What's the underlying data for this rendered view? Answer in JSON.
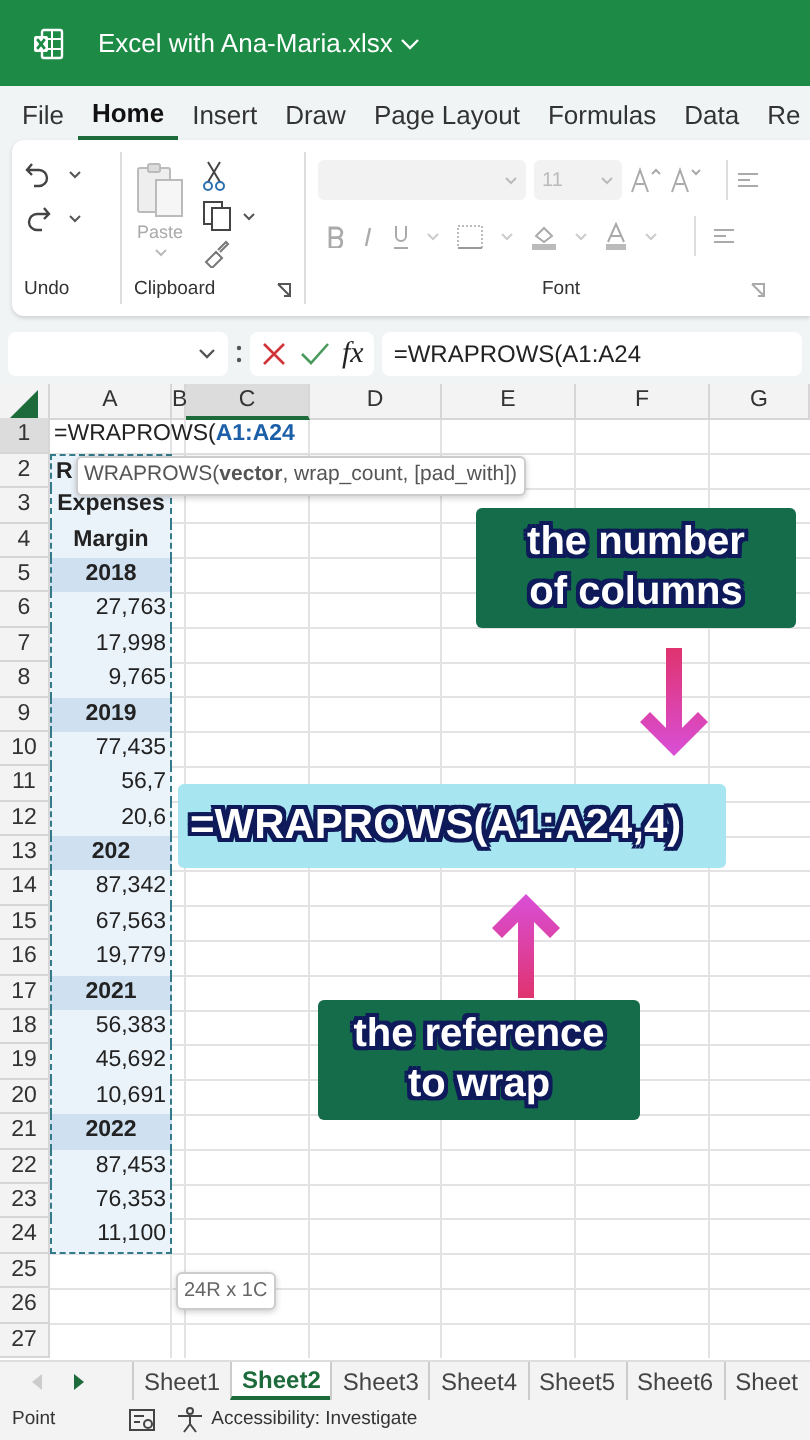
{
  "title_bar": {
    "file_name": "Excel with Ana-Maria.xlsx"
  },
  "menu_tabs": [
    {
      "label": "File",
      "selected": false
    },
    {
      "label": "Home",
      "selected": true
    },
    {
      "label": "Insert",
      "selected": false
    },
    {
      "label": "Draw",
      "selected": false
    },
    {
      "label": "Page Layout",
      "selected": false
    },
    {
      "label": "Formulas",
      "selected": false
    },
    {
      "label": "Data",
      "selected": false
    },
    {
      "label": "Re",
      "selected": false
    }
  ],
  "ribbon": {
    "paste_label": "Paste",
    "font_size": "11",
    "groups": [
      {
        "label": "Undo"
      },
      {
        "label": "Clipboard"
      },
      {
        "label": "Font"
      }
    ]
  },
  "formula_bar": {
    "function_button": "fx",
    "formula": "=WRAPROWS(A1:A24"
  },
  "columns": [
    {
      "label": "A",
      "selected": false
    },
    {
      "label": "B",
      "selected": false
    },
    {
      "label": "C",
      "selected": true
    },
    {
      "label": "D",
      "selected": false
    },
    {
      "label": "E",
      "selected": false
    },
    {
      "label": "F",
      "selected": false
    },
    {
      "label": "G",
      "selected": false
    }
  ],
  "rows": [
    {
      "number": "1",
      "selected": true,
      "kind": "formula",
      "formula_start": "=WRAPROWS(",
      "formula_reference": "A1:A24"
    },
    {
      "number": "2",
      "selected": false,
      "kind": "label",
      "in_range": true,
      "value": "R"
    },
    {
      "number": "3",
      "selected": false,
      "kind": "header",
      "in_range": true,
      "value": "Expenses"
    },
    {
      "number": "4",
      "selected": false,
      "kind": "header",
      "in_range": true,
      "value": "Margin"
    },
    {
      "number": "5",
      "selected": false,
      "kind": "year",
      "in_range": true,
      "value": "2018"
    },
    {
      "number": "6",
      "selected": false,
      "kind": "value",
      "in_range": true,
      "value": "27,763"
    },
    {
      "number": "7",
      "selected": false,
      "kind": "value",
      "in_range": true,
      "value": "17,998"
    },
    {
      "number": "8",
      "selected": false,
      "kind": "value",
      "in_range": true,
      "value": "9,765"
    },
    {
      "number": "9",
      "selected": false,
      "kind": "year",
      "in_range": true,
      "value": "2019"
    },
    {
      "number": "10",
      "selected": false,
      "kind": "value",
      "in_range": true,
      "value": "77,435"
    },
    {
      "number": "11",
      "selected": false,
      "kind": "value",
      "in_range": true,
      "value": "56,7"
    },
    {
      "number": "12",
      "selected": false,
      "kind": "value",
      "in_range": true,
      "value": "20,6"
    },
    {
      "number": "13",
      "selected": false,
      "kind": "year",
      "in_range": true,
      "value": "202"
    },
    {
      "number": "14",
      "selected": false,
      "kind": "value",
      "in_range": true,
      "value": "87,342"
    },
    {
      "number": "15",
      "selected": false,
      "kind": "value",
      "in_range": true,
      "value": "67,563"
    },
    {
      "number": "16",
      "selected": false,
      "kind": "value",
      "in_range": true,
      "value": "19,779"
    },
    {
      "number": "17",
      "selected": false,
      "kind": "year",
      "in_range": true,
      "value": "2021"
    },
    {
      "number": "18",
      "selected": false,
      "kind": "value",
      "in_range": true,
      "value": "56,383"
    },
    {
      "number": "19",
      "selected": false,
      "kind": "value",
      "in_range": true,
      "value": "45,692"
    },
    {
      "number": "20",
      "selected": false,
      "kind": "value",
      "in_range": true,
      "value": "10,691"
    },
    {
      "number": "21",
      "selected": false,
      "kind": "year",
      "in_range": true,
      "value": "2022"
    },
    {
      "number": "22",
      "selected": false,
      "kind": "value",
      "in_range": true,
      "value": "87,453"
    },
    {
      "number": "23",
      "selected": false,
      "kind": "value",
      "in_range": true,
      "value": "76,353"
    },
    {
      "number": "24",
      "selected": false,
      "kind": "value",
      "in_range": true,
      "value": "11,100"
    },
    {
      "number": "25",
      "selected": false,
      "kind": "empty"
    },
    {
      "number": "26",
      "selected": false,
      "kind": "empty"
    },
    {
      "number": "27",
      "selected": false,
      "kind": "empty"
    }
  ],
  "function_tooltip": {
    "text": "WRAPROWS(**vector**, wrap_count, [pad_with])"
  },
  "range_tooltip": {
    "text": "24R x 1C"
  },
  "callouts": [
    {
      "kind": "label",
      "text": "the number of columns"
    },
    {
      "kind": "formula",
      "text": "=WRAPROWS(A1:A24,4)"
    },
    {
      "kind": "label",
      "text": "the reference to wrap"
    }
  ],
  "sheet_tabs": [
    {
      "label": "Sheet1",
      "selected": false
    },
    {
      "label": "Sheet2",
      "selected": true
    },
    {
      "label": "Sheet3",
      "selected": false
    },
    {
      "label": "Sheet4",
      "selected": false
    },
    {
      "label": "Sheet5",
      "selected": false
    },
    {
      "label": "Sheet6",
      "selected": false
    },
    {
      "label": "Sheet",
      "selected": false
    }
  ],
  "status_bar": {
    "mode": "Point",
    "accessibility": "Accessibility: Investigate"
  }
}
